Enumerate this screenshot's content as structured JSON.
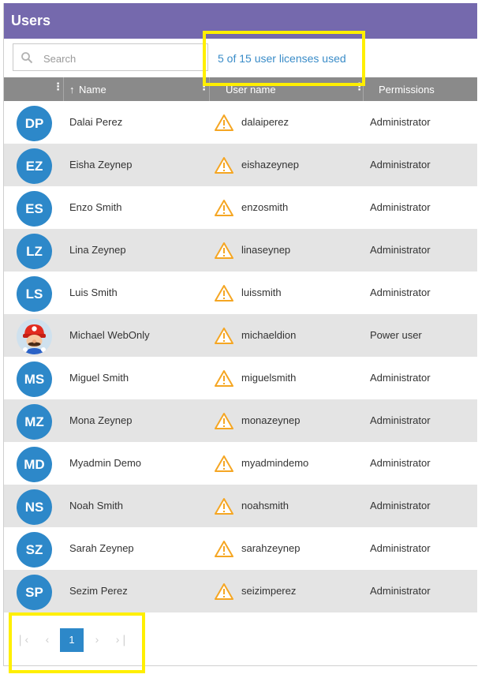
{
  "header": {
    "title": "Users"
  },
  "search": {
    "placeholder": "Search",
    "value": ""
  },
  "licenses_text": "5 of 15 user licenses used",
  "columns": {
    "name": "Name",
    "sort_indicator": "↑",
    "username": "User name",
    "permissions": "Permissions"
  },
  "rows": [
    {
      "initials": "DP",
      "name": "Dalai Perez",
      "username": "dalaiperez",
      "permission": "Administrator"
    },
    {
      "initials": "EZ",
      "name": "Eisha Zeynep",
      "username": "eishazeynep",
      "permission": "Administrator"
    },
    {
      "initials": "ES",
      "name": "Enzo Smith",
      "username": "enzosmith",
      "permission": "Administrator"
    },
    {
      "initials": "LZ",
      "name": "Lina Zeynep",
      "username": "linaseynep",
      "permission": "Administrator"
    },
    {
      "initials": "LS",
      "name": "Luis Smith",
      "username": "luissmith",
      "permission": "Administrator"
    },
    {
      "initials": "",
      "name": "Michael WebOnly",
      "username": "michaeldion",
      "permission": "Power user"
    },
    {
      "initials": "MS",
      "name": "Miguel Smith",
      "username": "miguelsmith",
      "permission": "Administrator"
    },
    {
      "initials": "MZ",
      "name": "Mona Zeynep",
      "username": "monazeynep",
      "permission": "Administrator"
    },
    {
      "initials": "MD",
      "name": "Myadmin Demo",
      "username": "myadmindemo",
      "permission": "Administrator"
    },
    {
      "initials": "NS",
      "name": "Noah Smith",
      "username": "noahsmith",
      "permission": "Administrator"
    },
    {
      "initials": "SZ",
      "name": "Sarah Zeynep",
      "username": "sarahzeynep",
      "permission": "Administrator"
    },
    {
      "initials": "SP",
      "name": "Sezim Perez",
      "username": "seizimperez",
      "permission": "Administrator"
    }
  ],
  "pager": {
    "current_page": "1"
  },
  "icons": {
    "row_status": "warning-icon",
    "search": "search-icon",
    "column_menu": "kebab-menu-icon",
    "pager": [
      "first-page-icon",
      "prev-page-icon",
      "next-page-icon",
      "last-page-icon"
    ]
  },
  "colors": {
    "header_bg": "#7569ad",
    "avatar_bg": "#2d88c9",
    "accent_link": "#3a8cc8",
    "warning": "#f5a623",
    "table_header_bg": "#8a8a8a",
    "alt_row_bg": "#e4e4e4",
    "highlight": "#ffef00"
  }
}
